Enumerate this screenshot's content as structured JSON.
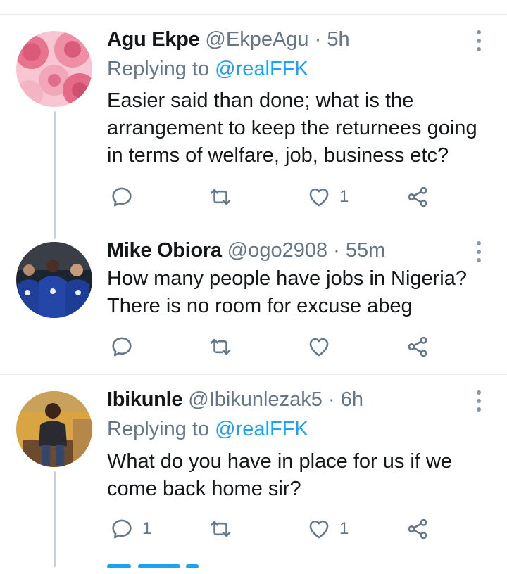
{
  "tweets": [
    {
      "name": "Agu Ekpe",
      "handle": "@EkpeAgu",
      "time": "5h",
      "replying_prefix": "Replying to",
      "replying_to": "@realFFK",
      "text": "Easier said than done; what is the arrangement to keep the returnees going in terms of welfare, job, business etc?",
      "counts": {
        "reply": "",
        "retweet": "",
        "like": "1"
      }
    },
    {
      "name": "Mike Obiora",
      "handle": "@ogo2908",
      "time": "55m",
      "text": "How many people have jobs in Nigeria? There is no room for excuse abeg",
      "counts": {
        "reply": "",
        "retweet": "",
        "like": ""
      }
    },
    {
      "name": "Ibikunle",
      "handle": "@Ibikunlezak5",
      "time": "6h",
      "replying_prefix": "Replying to",
      "replying_to": "@realFFK",
      "text": "What do you have in place for us if we come back home sir?",
      "counts": {
        "reply": "1",
        "retweet": "",
        "like": "1"
      }
    }
  ],
  "separator": "·",
  "icons": [
    "reply-icon",
    "retweet-icon",
    "like-icon",
    "share-icon",
    "more-options-icon"
  ],
  "colors": {
    "link": "#1da1f2",
    "secondary_text": "#657786",
    "icon": "#657786",
    "thread_line": "#c6d0d7"
  }
}
